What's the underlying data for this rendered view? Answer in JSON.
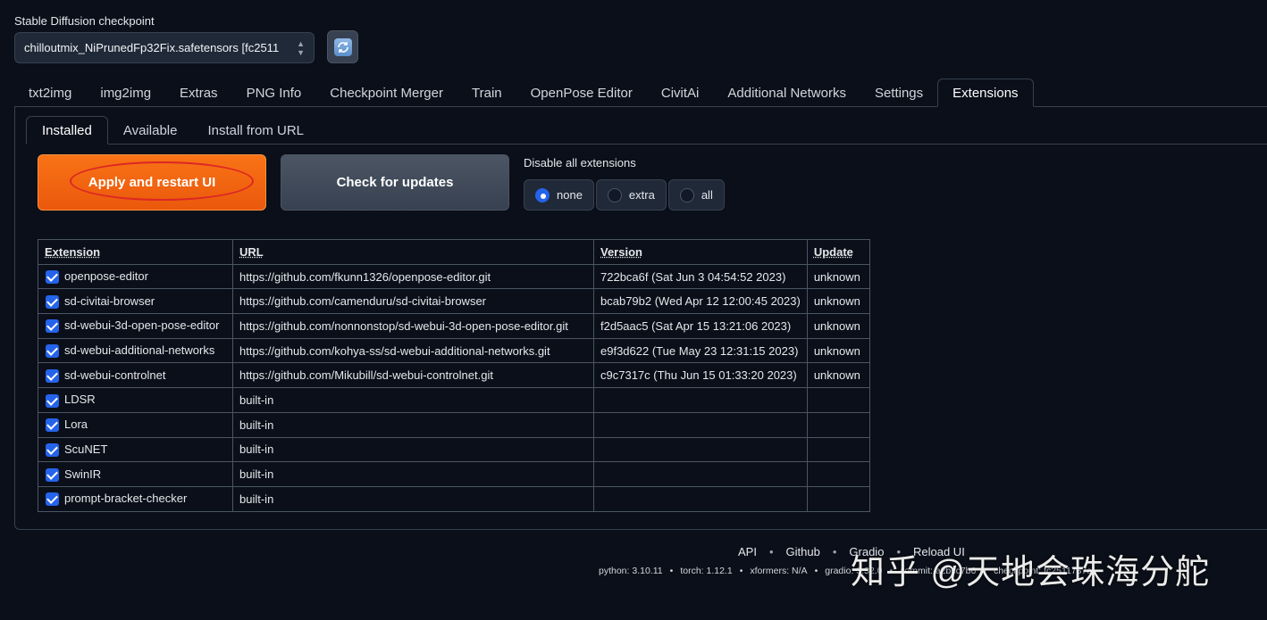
{
  "checkpoint": {
    "label": "Stable Diffusion checkpoint",
    "value": "chilloutmix_NiPrunedFp32Fix.safetensors [fc2511",
    "refresh_icon": "refresh-icon"
  },
  "main_tabs": [
    {
      "label": "txt2img"
    },
    {
      "label": "img2img"
    },
    {
      "label": "Extras"
    },
    {
      "label": "PNG Info"
    },
    {
      "label": "Checkpoint Merger"
    },
    {
      "label": "Train"
    },
    {
      "label": "OpenPose Editor"
    },
    {
      "label": "CivitAi"
    },
    {
      "label": "Additional Networks"
    },
    {
      "label": "Settings"
    },
    {
      "label": "Extensions",
      "active": true
    }
  ],
  "sub_tabs": [
    {
      "label": "Installed",
      "active": true
    },
    {
      "label": "Available"
    },
    {
      "label": "Install from URL"
    }
  ],
  "actions": {
    "apply_label": "Apply and restart UI",
    "check_label": "Check for updates"
  },
  "disable": {
    "label": "Disable all extensions",
    "options": [
      "none",
      "extra",
      "all"
    ],
    "selected": "none"
  },
  "table": {
    "headers": [
      "Extension",
      "URL",
      "Version",
      "Update"
    ],
    "rows": [
      {
        "name": "openpose-editor",
        "url": "https://github.com/fkunn1326/openpose-editor.git",
        "version": "722bca6f (Sat Jun 3 04:54:52 2023)",
        "update": "unknown"
      },
      {
        "name": "sd-civitai-browser",
        "url": "https://github.com/camenduru/sd-civitai-browser",
        "version": "bcab79b2 (Wed Apr 12 12:00:45 2023)",
        "update": "unknown"
      },
      {
        "name": "sd-webui-3d-open-pose-editor",
        "url": "https://github.com/nonnonstop/sd-webui-3d-open-pose-editor.git",
        "version": "f2d5aac5 (Sat Apr 15 13:21:06 2023)",
        "update": "unknown"
      },
      {
        "name": "sd-webui-additional-networks",
        "url": "https://github.com/kohya-ss/sd-webui-additional-networks.git",
        "version": "e9f3d622 (Tue May 23 12:31:15 2023)",
        "update": "unknown"
      },
      {
        "name": "sd-webui-controlnet",
        "url": "https://github.com/Mikubill/sd-webui-controlnet.git",
        "version": "c9c7317c (Thu Jun 15 01:33:20 2023)",
        "update": "unknown"
      },
      {
        "name": "LDSR",
        "url": "built-in",
        "version": "",
        "update": ""
      },
      {
        "name": "Lora",
        "url": "built-in",
        "version": "",
        "update": ""
      },
      {
        "name": "ScuNET",
        "url": "built-in",
        "version": "",
        "update": ""
      },
      {
        "name": "SwinIR",
        "url": "built-in",
        "version": "",
        "update": ""
      },
      {
        "name": "prompt-bracket-checker",
        "url": "built-in",
        "version": "",
        "update": ""
      }
    ]
  },
  "footer": {
    "links": [
      "API",
      "Github",
      "Gradio",
      "Reload UI"
    ],
    "info": [
      "python: 3.10.11",
      "torch: 1.12.1",
      "xformers: N/A",
      "gradio: 3.32.0",
      "commit: a2bcc7b6",
      "checkpoint: fc2511737a"
    ]
  },
  "watermark": "知乎 @天地会珠海分舵"
}
